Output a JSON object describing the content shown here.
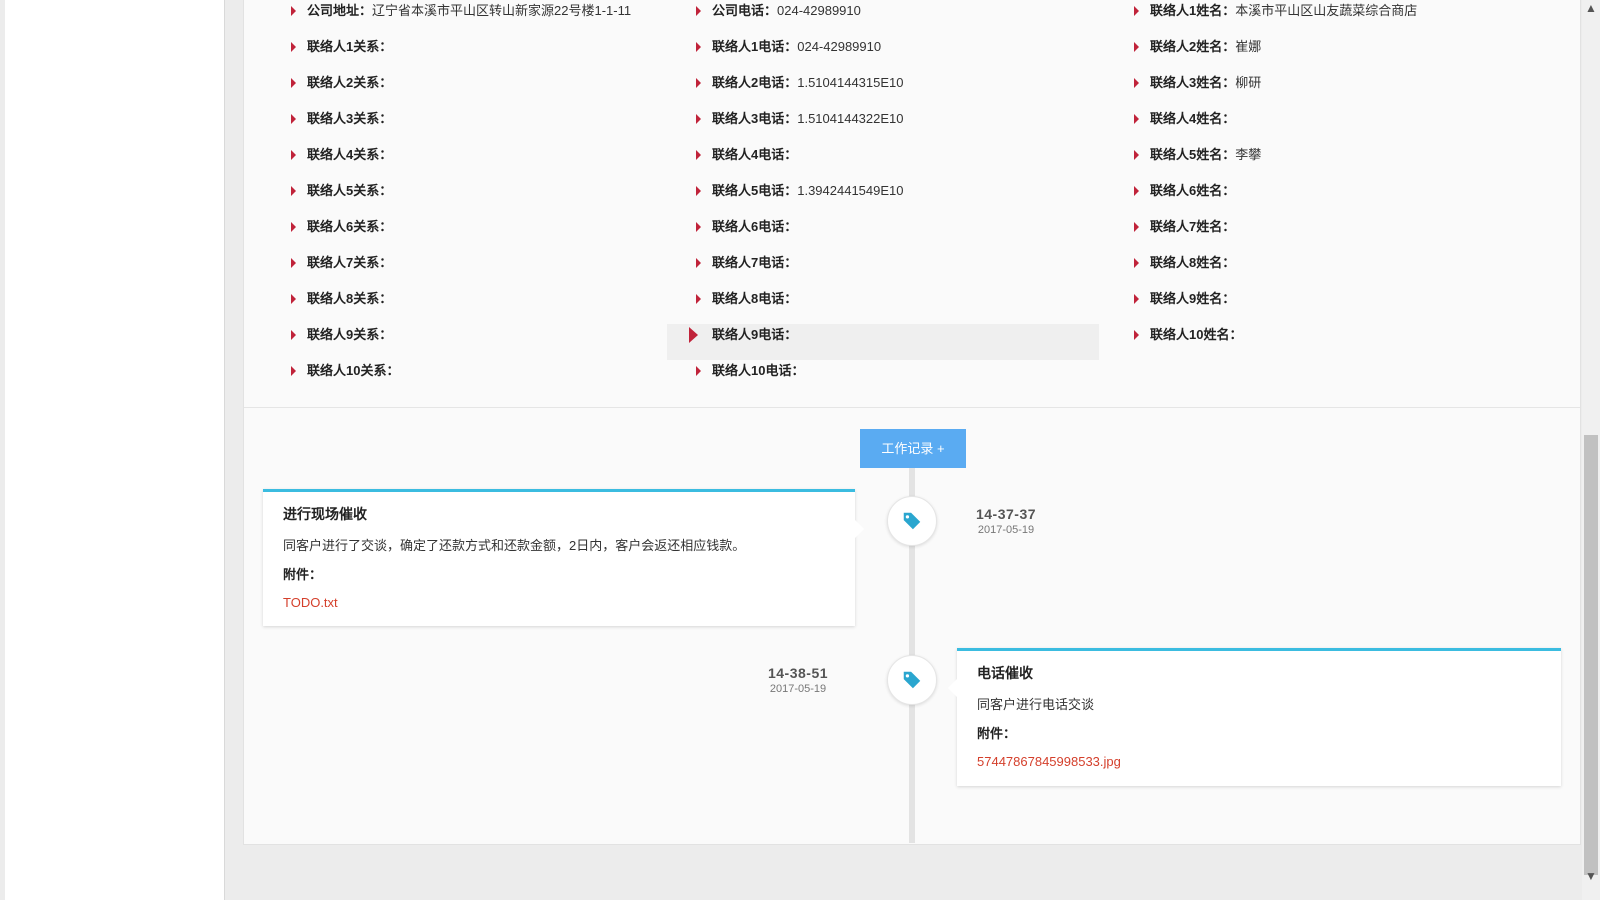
{
  "info_columns": [
    [
      {
        "label": "公司地址：",
        "value": "辽宁省本溪市平山区转山新家源22号楼1-1-11"
      },
      {
        "label": "联络人1关系：",
        "value": ""
      },
      {
        "label": "联络人2关系：",
        "value": ""
      },
      {
        "label": "联络人3关系：",
        "value": ""
      },
      {
        "label": "联络人4关系：",
        "value": ""
      },
      {
        "label": "联络人5关系：",
        "value": ""
      },
      {
        "label": "联络人6关系：",
        "value": ""
      },
      {
        "label": "联络人7关系：",
        "value": ""
      },
      {
        "label": "联络人8关系：",
        "value": ""
      },
      {
        "label": "联络人9关系：",
        "value": ""
      },
      {
        "label": "联络人10关系：",
        "value": ""
      }
    ],
    [
      {
        "label": "公司电话：",
        "value": "024-42989910"
      },
      {
        "label": "联络人1电话：",
        "value": "024-42989910"
      },
      {
        "label": "联络人2电话：",
        "value": "1.5104144315E10"
      },
      {
        "label": "联络人3电话：",
        "value": "1.5104144322E10"
      },
      {
        "label": "联络人4电话：",
        "value": ""
      },
      {
        "label": "联络人5电话：",
        "value": "1.3942441549E10"
      },
      {
        "label": "联络人6电话：",
        "value": ""
      },
      {
        "label": "联络人7电话：",
        "value": ""
      },
      {
        "label": "联络人8电话：",
        "value": ""
      },
      {
        "label": "联络人9电话：",
        "value": ""
      },
      {
        "label": "联络人10电话：",
        "value": ""
      }
    ],
    [
      {
        "label": "联络人1姓名：",
        "value": "本溪市平山区山友蔬菜综合商店"
      },
      {
        "label": "联络人2姓名：",
        "value": "崔娜"
      },
      {
        "label": "联络人3姓名：",
        "value": "柳研"
      },
      {
        "label": "联络人4姓名：",
        "value": ""
      },
      {
        "label": "联络人5姓名：",
        "value": "李攀"
      },
      {
        "label": "联络人6姓名：",
        "value": ""
      },
      {
        "label": "联络人7姓名：",
        "value": ""
      },
      {
        "label": "联络人8姓名：",
        "value": ""
      },
      {
        "label": "联络人9姓名：",
        "value": ""
      },
      {
        "label": "联络人10姓名：",
        "value": ""
      }
    ]
  ],
  "add_record_label": "工作记录 +",
  "timeline": [
    {
      "title": "进行现场催收",
      "body": "同客户进行了交谈，确定了还款方式和还款金额，2日内，客户会返还相应钱款。",
      "attach_label": "附件：",
      "attachment": "TODO.txt",
      "time": "14-37-37",
      "date": "2017-05-19",
      "icon": "tag-icon"
    },
    {
      "title": "电话催收",
      "body": "同客户进行电话交谈",
      "attach_label": "附件：",
      "attachment": "57447867845998533.jpg",
      "time": "14-38-51",
      "date": "2017-05-19",
      "icon": "tag-icon"
    }
  ],
  "colors": {
    "accent": "#3bbce0",
    "button": "#5aabf2",
    "arrow": "#c0233a",
    "link": "#d43f2b"
  }
}
